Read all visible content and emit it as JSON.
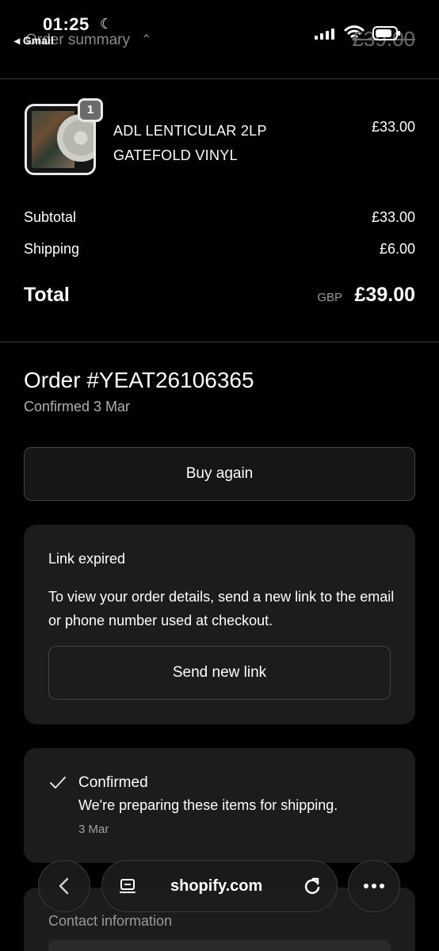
{
  "status_bar": {
    "time": "01:25",
    "back_app": "◂ Gmail",
    "order_summary_label": "Order summary",
    "header_total": "£39.00"
  },
  "line_item": {
    "quantity": "1",
    "title_line1": "ADL LENTICULAR 2LP",
    "title_line2": "GATEFOLD VINYL",
    "price": "£33.00"
  },
  "summary": {
    "subtotal_label": "Subtotal",
    "subtotal_value": "£33.00",
    "shipping_label": "Shipping",
    "shipping_value": "£6.00",
    "total_label": "Total",
    "currency": "GBP",
    "total_value": "£39.00"
  },
  "order": {
    "number": "Order #YEAT26106365",
    "confirmed_date": "Confirmed 3 Mar",
    "buy_again_label": "Buy again"
  },
  "link_card": {
    "title": "Link expired",
    "body": "To view your order details, send a new link to the email or phone number used at checkout.",
    "button_label": "Send new link"
  },
  "status_card": {
    "title": "Confirmed",
    "body": "We're preparing these items for shipping.",
    "date": "3 Mar"
  },
  "contact_card": {
    "title": "Contact information"
  },
  "browser": {
    "url": "shopify.com"
  },
  "icons": [
    "moon-icon",
    "caret-up-icon",
    "signal-icon",
    "wifi-icon",
    "battery-icon",
    "checkmark-icon",
    "back-arrow-icon",
    "reader-icon",
    "reload-icon",
    "more-icon"
  ]
}
